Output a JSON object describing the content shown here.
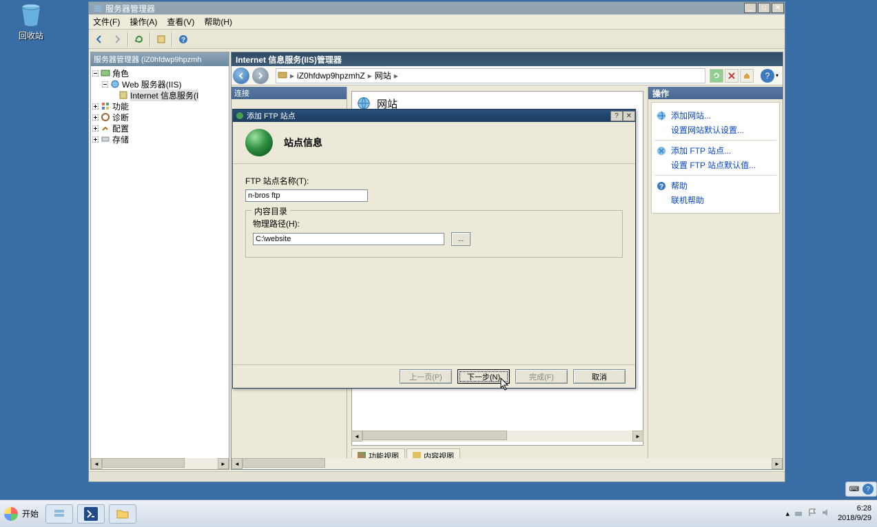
{
  "desktop": {
    "recyclebin": "回收站"
  },
  "server_manager": {
    "title": "服务器管理器",
    "menus": {
      "file": "文件(F)",
      "action": "操作(A)",
      "view": "查看(V)",
      "help": "帮助(H)"
    },
    "tree_header": "服务器管理器 (iZ0hfdwp9hpzmh",
    "tree": {
      "roles": "角色",
      "web_iis": "Web 服务器(IIS)",
      "iis_service": "Internet 信息服务(I",
      "features": "功能",
      "diagnostics": "诊断",
      "config": "配置",
      "storage": "存储"
    }
  },
  "iis": {
    "title": "Internet 信息服务(IIS)管理器",
    "breadcrumb": {
      "host": "iZ0hfdwp9hpzmhZ",
      "sites": "网站"
    },
    "connections_title": "连接",
    "center_heading": "网站",
    "featureview": "功能视图",
    "contentview": "内容视图",
    "actions_title": "操作",
    "actions": {
      "add_site": "添加网站...",
      "set_site_defaults": "设置网站默认设置...",
      "add_ftp": "添加 FTP 站点...",
      "set_ftp_defaults": "设置 FTP 站点默认值...",
      "help": "帮助",
      "online_help": "联机帮助"
    }
  },
  "dialog": {
    "window_title": "添加 FTP 站点",
    "heading": "站点信息",
    "site_name_label": "FTP 站点名称(T):",
    "site_name_value": "n-bros ftp",
    "group_legend": "内容目录",
    "path_label": "物理路径(H):",
    "path_value": "C:\\website",
    "browse": "...",
    "buttons": {
      "prev": "上一页(P)",
      "next": "下一步(N)",
      "finish": "完成(F)",
      "cancel": "取消"
    }
  },
  "taskbar": {
    "start": "开始",
    "clock_time": "6:28",
    "clock_date": "2018/9/29"
  }
}
